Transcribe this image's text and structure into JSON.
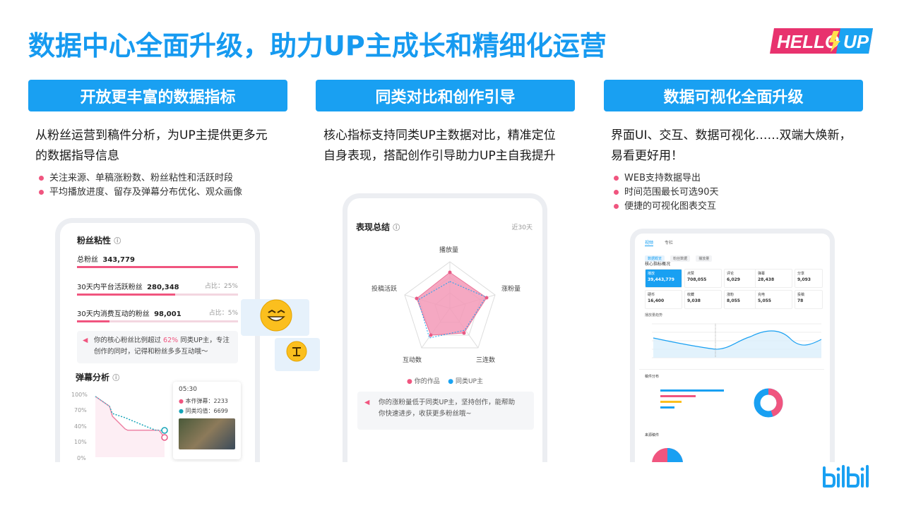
{
  "header": {
    "title": "数据中心全面升级，助力UP主成长和精细化运营",
    "logo_text": "HELLO UP"
  },
  "columns": [
    {
      "heading": "开放更丰富的数据指标",
      "desc_line1": "从粉丝运营到稿件分析，为UP主提供更多元",
      "desc_line2": "的数据指导信息",
      "bullets": [
        "关注来源、单稿涨粉数、粉丝粘性和活跃时段",
        "平均播放进度、留存及弹幕分布优化、观众画像"
      ]
    },
    {
      "heading": "同类对比和创作引导",
      "desc_line1": "核心指标支持同类UP主数据对比，精准定位",
      "desc_line2": "自身表现，搭配创作引导助力UP主自我提升",
      "bullets": []
    },
    {
      "heading": "数据可视化全面升级",
      "desc_line1": "界面UI、交互、数据可视化……双端大焕新，",
      "desc_line2": "易看更好用！",
      "bullets": [
        "WEB支持数据导出",
        "时间范围最长可选90天",
        "便捷的可视化图表交互"
      ]
    }
  ],
  "phone1": {
    "section_title": "粉丝粘性",
    "rows": [
      {
        "label": "总粉丝",
        "value": "343,779",
        "share": "",
        "fill": 1.0
      },
      {
        "label": "30天内平台活跃粉丝",
        "value": "280,348",
        "share": "占比：25%",
        "fill": 0.61
      },
      {
        "label": "30天内消费互动的粉丝",
        "value": "98,001",
        "share": "占比：5%",
        "fill": 0.2
      }
    ],
    "tip_pre": "你的核心粉丝比例超过",
    "tip_pct": "62%",
    "tip_post": "同类UP主，专注",
    "tip_line2": "创作的同时，记得和粉丝多多互动哦～",
    "danmu_title": "弹幕分析",
    "y_ticks": [
      "100%",
      "70%",
      "40%",
      "10%",
      "0%"
    ],
    "tooltip_time": "05:30",
    "tooltip_mine": "本作弹幕：2233",
    "tooltip_avg": "同类均值：6699"
  },
  "phone2": {
    "title": "表现总结",
    "range": "近30天",
    "axes": [
      "播放量",
      "涨粉量",
      "三连数",
      "互动数",
      "投稿活跃"
    ],
    "legend_mine": "你的作品",
    "legend_peer": "同类UP主",
    "tip_line1": "你的涨粉量低于同类UP主，坚持创作，能帮助",
    "tip_line2": "你快速进步，收获更多粉丝哦~"
  },
  "phone3": {
    "tabs": [
      "视频",
      "专栏"
    ],
    "subtabs": [
      "数据概览",
      "粉丝数据",
      "播放量"
    ],
    "panel_title": "核心指标概况",
    "stats": [
      {
        "label": "播放",
        "value": "39,443,779"
      },
      {
        "label": "点赞",
        "value": "708,055"
      },
      {
        "label": "评论",
        "value": "6,029"
      },
      {
        "label": "弹幕",
        "value": "28,438"
      },
      {
        "label": "分享",
        "value": "9,093"
      },
      {
        "label": "硬币",
        "value": "16,400"
      },
      {
        "label": "收藏",
        "value": "9,038"
      },
      {
        "label": "涨粉",
        "value": "8,055"
      },
      {
        "label": "充电",
        "value": "5,055"
      },
      {
        "label": "投稿",
        "value": "78"
      }
    ],
    "trend_label": "播放量趋势",
    "dist_title": "稿件分布",
    "source_title": "来源稿件"
  },
  "colors": {
    "primary": "#19a0f2",
    "pink": "#f0557f",
    "teal": "#16a4b8",
    "light_pink": "#f4a6c0"
  }
}
